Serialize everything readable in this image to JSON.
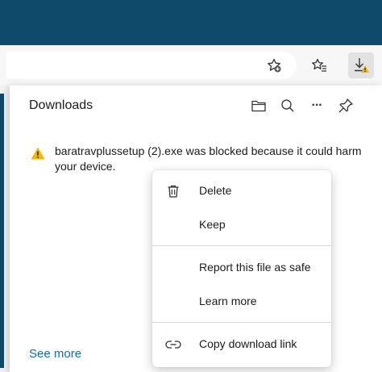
{
  "toolbar": {
    "add_favorite_icon": "star-plus-icon",
    "favorites_icon": "favorites-list-icon",
    "downloads_icon": "download-warning-icon"
  },
  "downloads_panel": {
    "title": "Downloads",
    "header_icons": [
      "folder-icon",
      "search-icon",
      "more-icon",
      "pin-icon"
    ],
    "more_label": "···",
    "item": {
      "status_icon": "warning-icon",
      "message": "baratravplussetup (2).exe was blocked because it could harm your device."
    },
    "see_more": "See more"
  },
  "context_menu": {
    "delete": "Delete",
    "keep": "Keep",
    "report_safe": "Report this file as safe",
    "learn_more": "Learn more",
    "copy_link": "Copy download link"
  },
  "colors": {
    "titlebar": "#0f4a6b",
    "link": "#0f6cbd",
    "warning": "#f2b705"
  }
}
